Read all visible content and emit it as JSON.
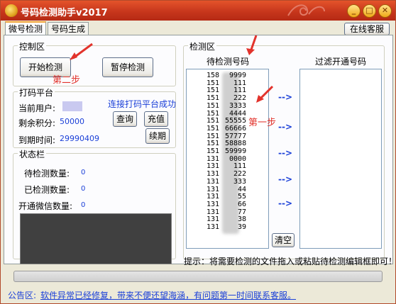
{
  "window": {
    "title": "号码检测助手v2017",
    "min": "_",
    "max": "□",
    "close": "✕"
  },
  "tabs": [
    "微号检测",
    "号码生成"
  ],
  "online_service": "在线客服",
  "control": {
    "group_label": "控制区",
    "start_btn": "开始检测",
    "pause_btn": "暂停检测",
    "annot_step2": "第二步"
  },
  "platform": {
    "group_label": "打码平台",
    "connect_status": "连接打码平台成功",
    "user_label": "当前用户:",
    "points_label": "剩余积分:",
    "points_value": "50000",
    "expiry_label": "到期时间:",
    "expiry_value": "29990409",
    "query_btn": "查询",
    "recharge_btn": "充值",
    "renew_btn": "续期"
  },
  "status": {
    "group_label": "状态栏",
    "pending_label": "待检测数量:",
    "pending_value": "0",
    "checked_label": "已检测数量:",
    "checked_value": "0",
    "wechat_label": "开通微信数量:",
    "wechat_value": "0"
  },
  "detect": {
    "group_label": "检测区",
    "pending_header": "待检测号码",
    "filter_header": "过滤开通号码",
    "arrow": "-->",
    "clear_btn": "清空",
    "annot_step1": "第一步",
    "numbers": [
      [
        "158",
        "9999"
      ],
      [
        "151",
        "111"
      ],
      [
        "151",
        "111"
      ],
      [
        "151",
        "222"
      ],
      [
        "151",
        "3333"
      ],
      [
        "151",
        "4444"
      ],
      [
        "151",
        "55555"
      ],
      [
        "151",
        "66666"
      ],
      [
        "151",
        "57777"
      ],
      [
        "151",
        "58888"
      ],
      [
        "151",
        "59999"
      ],
      [
        "131",
        "0000"
      ],
      [
        "131",
        "111"
      ],
      [
        "131",
        "222"
      ],
      [
        "131",
        "333"
      ],
      [
        "131",
        "44"
      ],
      [
        "131",
        "55"
      ],
      [
        "131",
        "66"
      ],
      [
        "131",
        "77"
      ],
      [
        "131",
        "38"
      ],
      [
        "131",
        "39"
      ]
    ]
  },
  "hint": "提示：将需要检测的文件拖入或粘贴待检测编辑框即可！",
  "notice": {
    "label": "公告区:",
    "text": "软件异常已经修复，带来不便还望海涵，有问题第一时间联系客服。"
  }
}
